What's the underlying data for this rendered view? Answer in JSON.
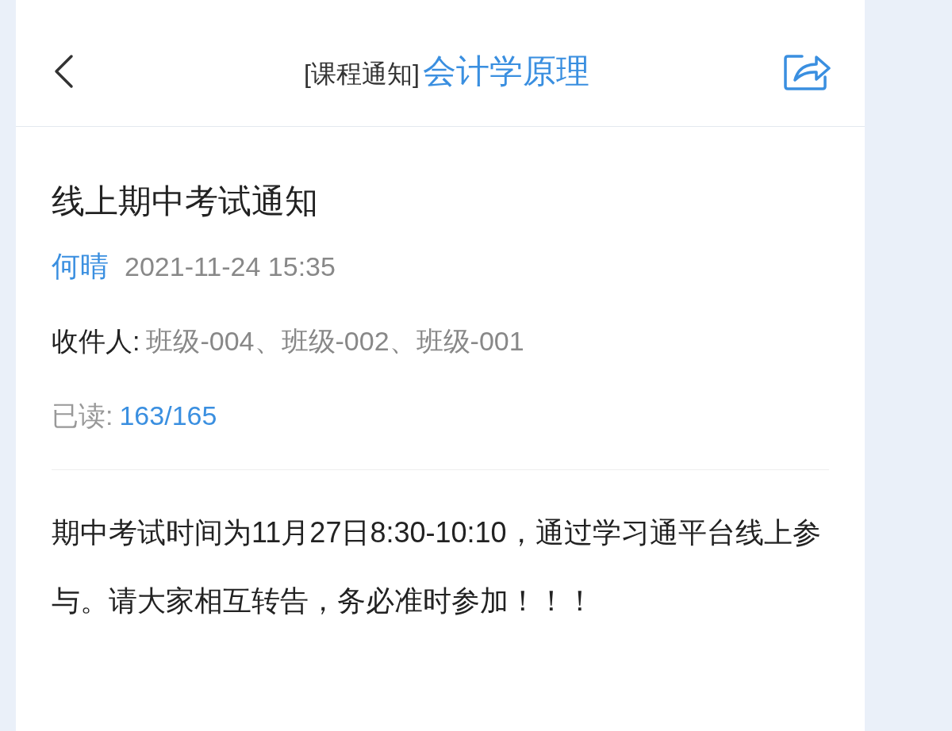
{
  "header": {
    "tag": "[课程通知]",
    "course": "会计学原理"
  },
  "notice": {
    "title": "线上期中考试通知",
    "author": "何晴",
    "time": "2021-11-24 15:35",
    "recipients_label": "收件人:",
    "recipients": "班级-004、班级-002、班级-001",
    "read_label": "已读:",
    "read_count": "163/165",
    "body": "期中考试时间为11月27日8:30-10:10，通过学习通平台线上参与。请大家相互转告，务必准时参加！！！"
  }
}
